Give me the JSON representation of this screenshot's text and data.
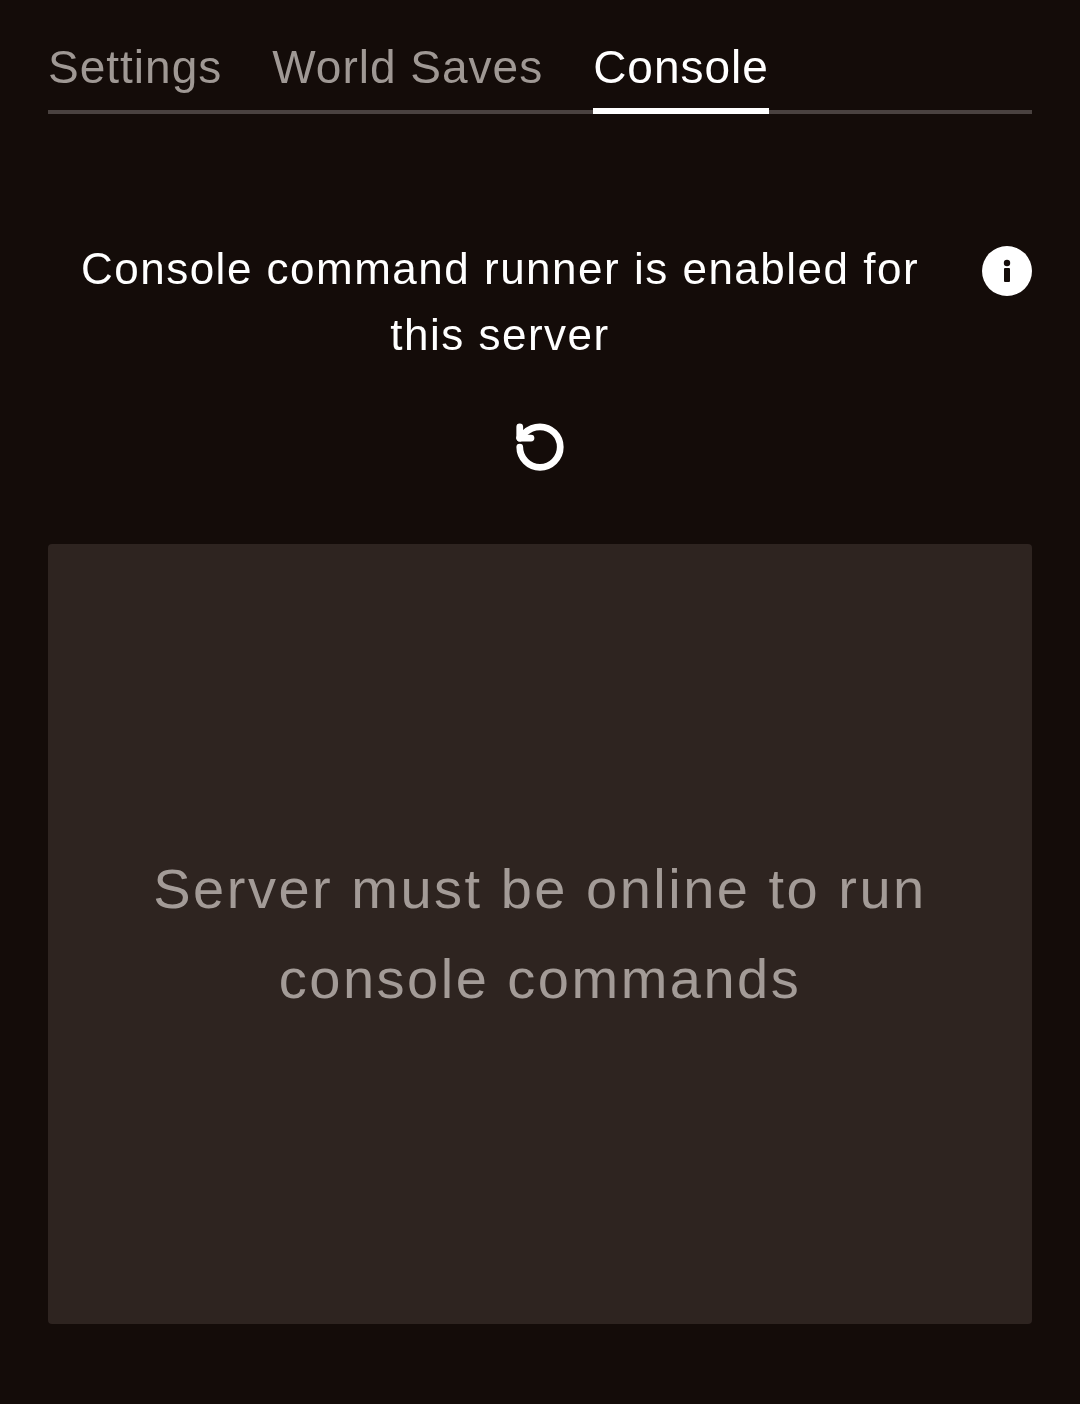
{
  "tabs": [
    {
      "label": "Settings",
      "selected": false
    },
    {
      "label": "World Saves",
      "selected": false
    },
    {
      "label": "Console",
      "selected": true
    }
  ],
  "status": {
    "text": "Console command runner is enabled for this server"
  },
  "console_panel": {
    "message": "Server must be online to run console commands"
  }
}
